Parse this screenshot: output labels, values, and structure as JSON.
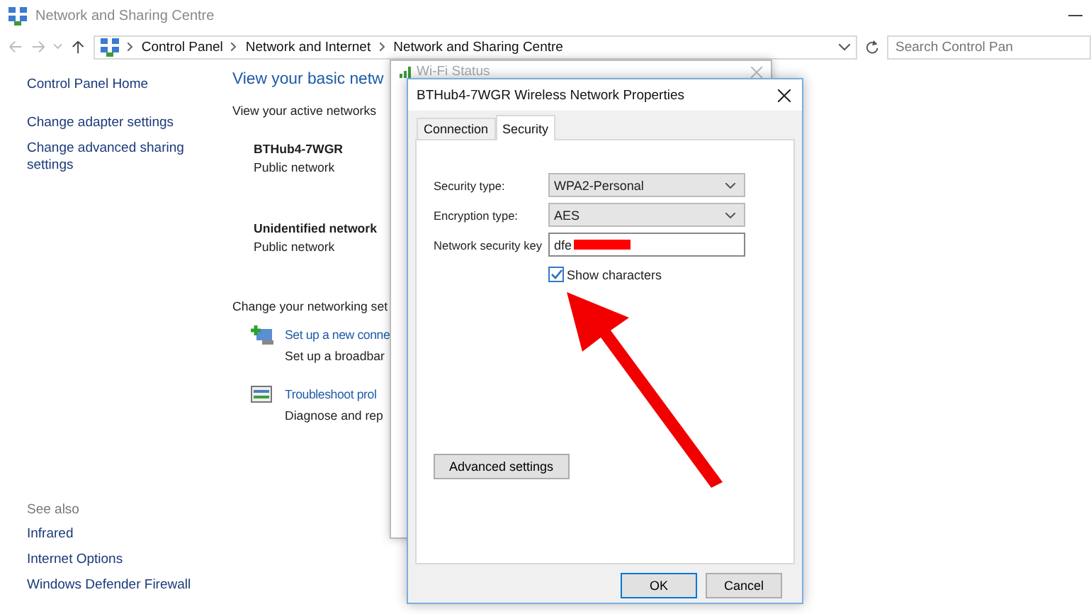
{
  "window": {
    "title": "Network and Sharing Centre"
  },
  "address_bar": {
    "breadcrumbs": [
      "Control Panel",
      "Network and Internet",
      "Network and Sharing Centre"
    ]
  },
  "search": {
    "placeholder": "Search Control Pan"
  },
  "sidebar": {
    "items": [
      "Control Panel Home",
      "Change adapter settings",
      "Change advanced sharing settings"
    ],
    "see_also_heading": "See also",
    "see_also": [
      "Infrared",
      "Internet Options",
      "Windows Defender Firewall"
    ]
  },
  "main": {
    "heading": "View your basic netw",
    "active_networks_label": "View your active networks",
    "networks": [
      {
        "name": "BTHub4-7WGR",
        "type": "Public network"
      },
      {
        "name": "Unidentified network",
        "type": "Public network"
      }
    ],
    "change_heading": "Change your networking set",
    "tasks": [
      {
        "kind": "add",
        "title": "Set up a new conne",
        "description": "Set up a broadbar"
      },
      {
        "kind": "troubleshoot",
        "title": "Troubleshoot prol",
        "description": "Diagnose and rep"
      }
    ]
  },
  "background_window": {
    "title": "Wi-Fi Status"
  },
  "dialog": {
    "title": "BTHub4-7WGR Wireless Network Properties",
    "tabs": [
      {
        "label": "Connection",
        "selected": false
      },
      {
        "label": "Security",
        "selected": true
      }
    ],
    "fields": [
      {
        "kind": "dropdown",
        "label": "Security type:",
        "value": "WPA2-Personal"
      },
      {
        "kind": "dropdown",
        "label": "Encryption type:",
        "value": "AES"
      },
      {
        "kind": "text",
        "label": "Network security key",
        "value": "dfe"
      }
    ],
    "show_characters": {
      "label": "Show characters",
      "checked": true
    },
    "advanced_button": "Advanced settings",
    "buttons": [
      {
        "label": "OK",
        "default": true
      },
      {
        "label": "Cancel",
        "default": false
      }
    ]
  }
}
